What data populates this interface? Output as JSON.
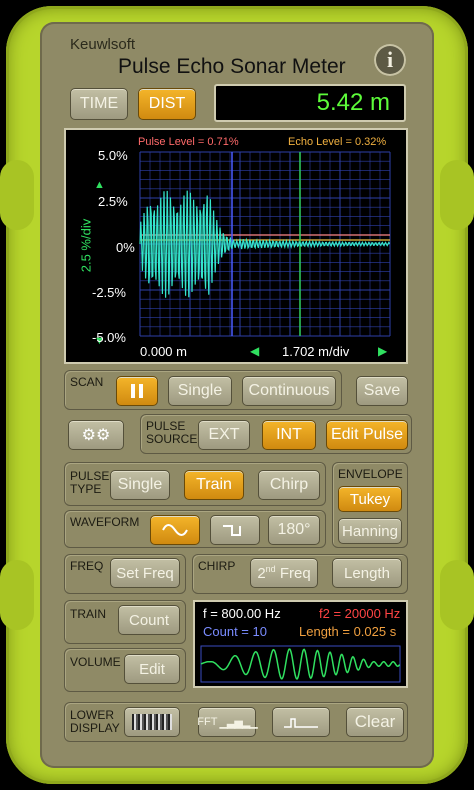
{
  "app": {
    "brand": "Keuwlsoft",
    "title": "Pulse Echo Sonar Meter",
    "info_icon": "i"
  },
  "mode": {
    "time_label": "TIME",
    "dist_label": "DIST",
    "readout": "5.42 m"
  },
  "scope": {
    "pulse_level": "Pulse Level = 0.71%",
    "echo_level": "Echo Level = 0.32%",
    "y_ticks": [
      "5.0%",
      "2.5%",
      "0%",
      "-2.5%",
      "-5.0%"
    ],
    "y_axis_label": "2.5 %/div",
    "x_start": "0.000 m",
    "x_scale": "1.702 m/div",
    "colors": {
      "grid": "#2e3fa8",
      "trace": "#35e6cc",
      "pulse_line": "#ff8888",
      "echo_line": "#f0c040",
      "cursor_blue": "#4a5cff",
      "cursor_green": "#30d060"
    }
  },
  "scan": {
    "label": "SCAN",
    "pause_icon": "pause-icon",
    "single": "Single",
    "continuous": "Continuous",
    "save": "Save"
  },
  "pulse_source": {
    "label": "PULSE\nSOURCE",
    "ext": "EXT",
    "int": "INT",
    "edit": "Edit Pulse",
    "settings_icon": "gear-icon"
  },
  "pulse_type": {
    "label": "PULSE\nTYPE",
    "single": "Single",
    "train": "Train",
    "chirp": "Chirp"
  },
  "envelope": {
    "label": "ENVELOPE",
    "tukey": "Tukey",
    "hanning": "Hanning"
  },
  "waveform": {
    "label": "WAVEFORM",
    "phase": "180°"
  },
  "freq": {
    "label": "FREQ",
    "set": "Set Freq"
  },
  "chirp": {
    "label": "CHIRP",
    "second_freq_sup": "nd",
    "second_freq_pre": "2",
    "second_freq_post": " Freq",
    "length": "Length"
  },
  "train": {
    "label": "TRAIN",
    "count": "Count"
  },
  "volume": {
    "label": "VOLUME",
    "edit": "Edit"
  },
  "preview": {
    "f": "f = 800.00 Hz",
    "f2": "f2 = 20000 Hz",
    "count": "Count = 10",
    "length": "Length = 0.025 s"
  },
  "lower_display": {
    "label": "LOWER\nDISPLAY",
    "fft": "FFT",
    "clear": "Clear"
  }
}
